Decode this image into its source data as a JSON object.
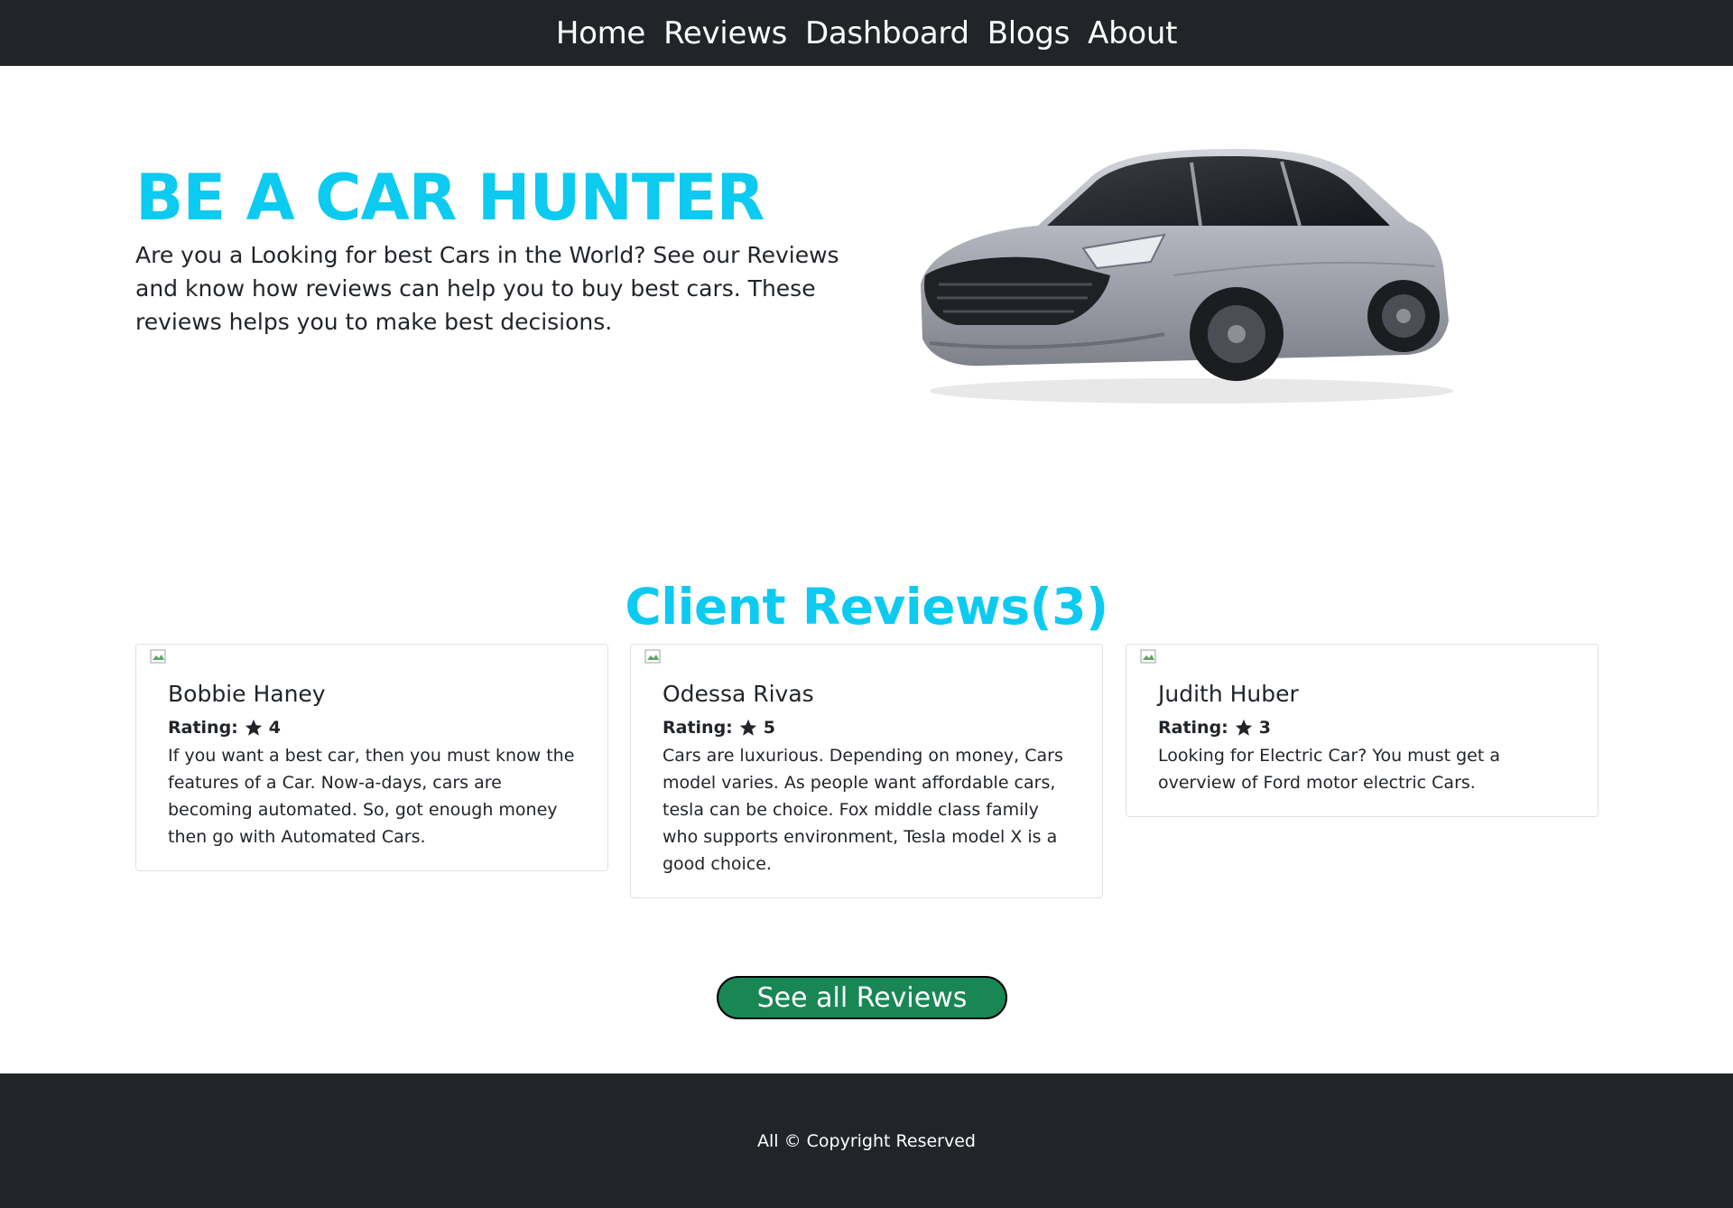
{
  "nav": {
    "items": [
      {
        "label": "Home"
      },
      {
        "label": "Reviews"
      },
      {
        "label": "Dashboard"
      },
      {
        "label": "Blogs"
      },
      {
        "label": "About"
      }
    ]
  },
  "hero": {
    "title": "BE A CAR HUNTER",
    "text": "Are you a Looking for best Cars in the World? See our Reviews and know how reviews can help you to buy best cars. These reviews helps you to make best decisions.",
    "image": "car-photo"
  },
  "reviews": {
    "title": "Client Reviews(3)",
    "rating_label": "Rating:",
    "items": [
      {
        "name": "Bobbie Haney",
        "rating": "4",
        "text": "If you want a best car, then you must know the features of a Car. Now-a-days, cars are becoming automated. So, got enough money then go with Automated Cars."
      },
      {
        "name": "Odessa Rivas",
        "rating": "5",
        "text": "Cars are luxurious. Depending on money, Cars model varies. As people want affordable cars, tesla can be choice. Fox middle class family who supports environment, Tesla model X is a good choice."
      },
      {
        "name": "Judith Huber",
        "rating": "3",
        "text": "Looking for Electric Car? You must get a overview of Ford motor electric Cars."
      }
    ],
    "button_label": "See all Reviews"
  },
  "footer": {
    "text": "All © Copyright Reserved"
  },
  "colors": {
    "accent": "#0dcaf0",
    "dark": "#212529",
    "button": "#198754"
  }
}
